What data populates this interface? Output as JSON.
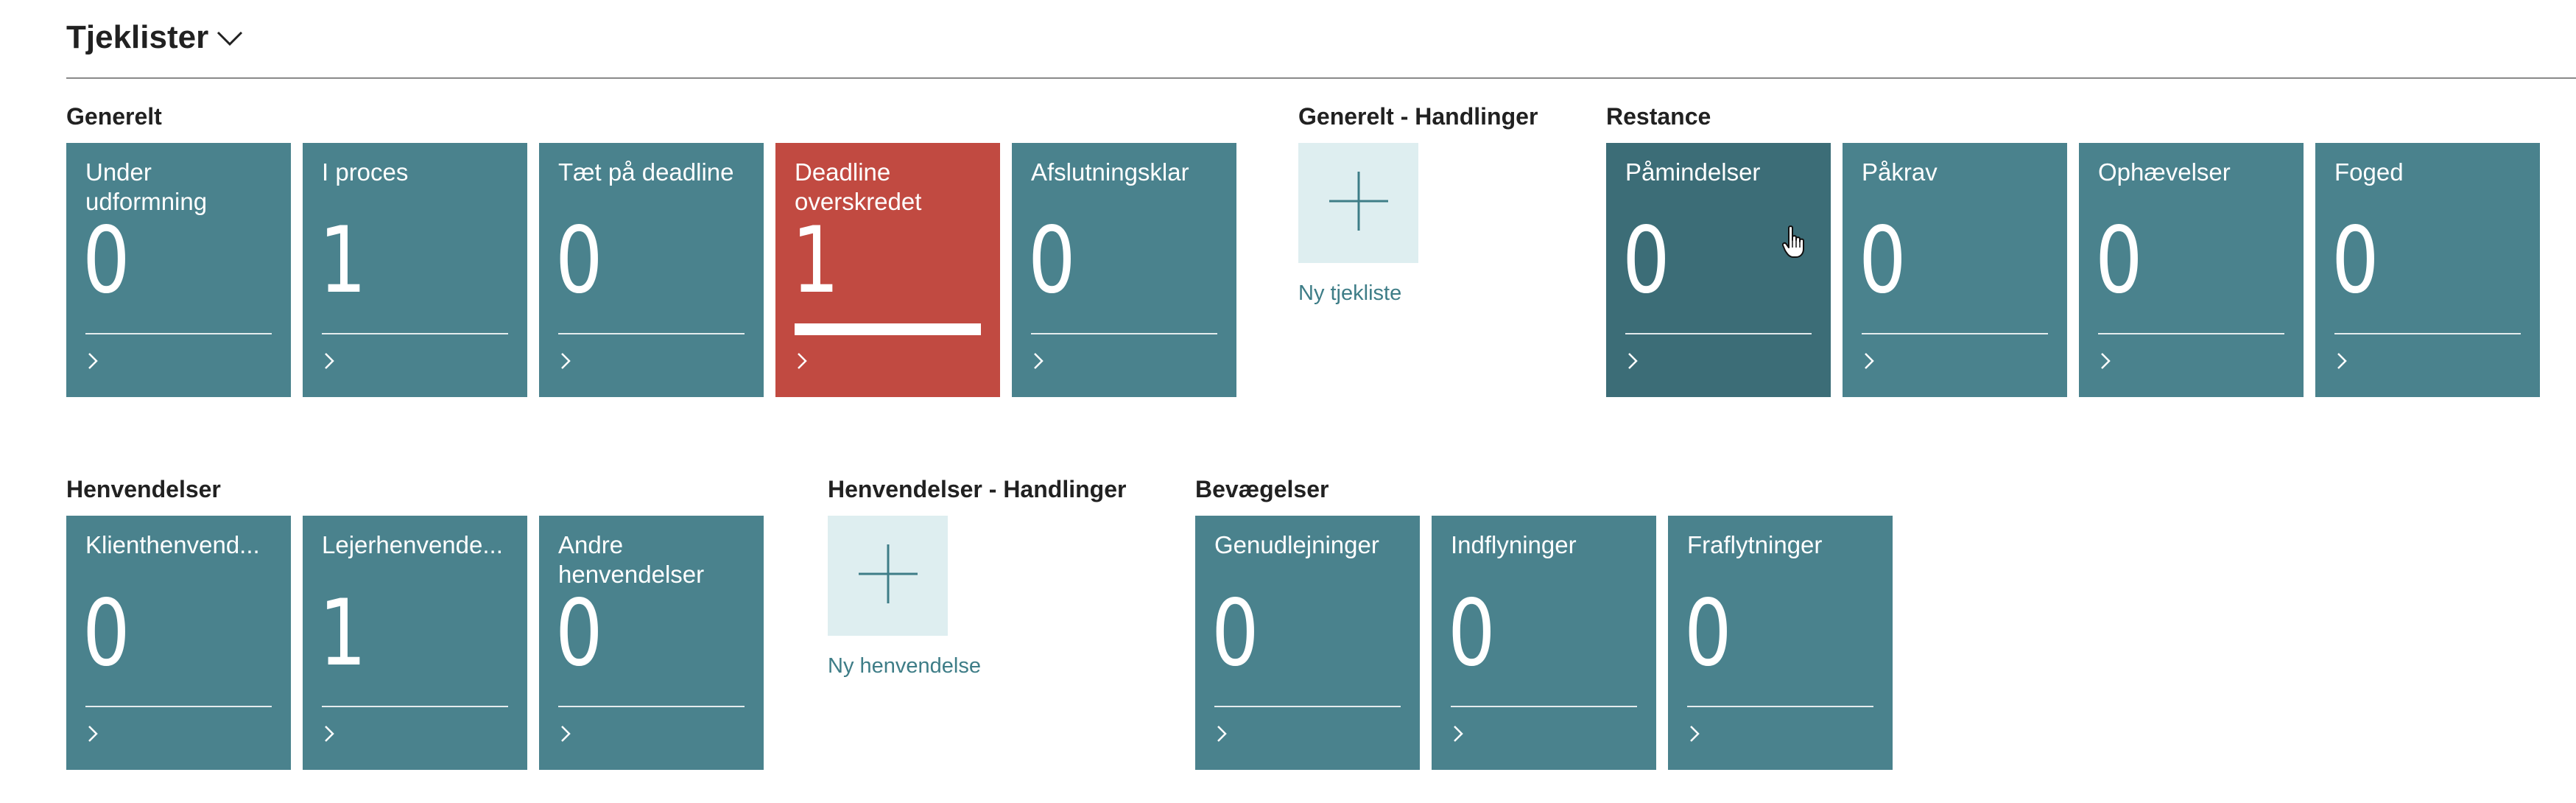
{
  "page": {
    "title": "Tjeklister"
  },
  "groups": {
    "generelt": {
      "title": "Generelt",
      "tiles": [
        {
          "label": "Under udformning",
          "value": "0"
        },
        {
          "label": "I proces",
          "value": "1"
        },
        {
          "label": "Tæt på deadline",
          "value": "0"
        },
        {
          "label": "Deadline overskredet",
          "value": "1"
        },
        {
          "label": "Afslutningsklar",
          "value": "0"
        }
      ]
    },
    "generelt_handlinger": {
      "title": "Generelt - Handlinger",
      "action_label": "Ny tjekliste"
    },
    "restance": {
      "title": "Restance",
      "tiles": [
        {
          "label": "Påmindelser",
          "value": "0"
        },
        {
          "label": "Påkrav",
          "value": "0"
        },
        {
          "label": "Ophævelser",
          "value": "0"
        },
        {
          "label": "Foged",
          "value": "0"
        }
      ]
    },
    "henvendelser": {
      "title": "Henvendelser",
      "tiles": [
        {
          "label": "Klienthenvend...",
          "value": "0"
        },
        {
          "label": "Lejerhenvende...",
          "value": "1"
        },
        {
          "label": "Andre henvendelser",
          "value": "0"
        }
      ]
    },
    "henvendelser_handlinger": {
      "title": "Henvendelser - Handlinger",
      "action_label": "Ny henvendelse"
    },
    "bevaegelser": {
      "title": "Bevægelser",
      "tiles": [
        {
          "label": "Genudlejninger",
          "value": "0"
        },
        {
          "label": "Indflyninger",
          "value": "0"
        },
        {
          "label": "Fraflytninger",
          "value": "0"
        }
      ]
    }
  },
  "colors": {
    "tile": "#4a828d",
    "tile_hover": "#3c6d77",
    "tile_alert": "#c14a41",
    "action_tile": "#deeef0",
    "link": "#3e7d87"
  },
  "icons": {
    "title_chevron": "chevron-down-icon",
    "tile_arrow": "chevron-right-icon",
    "action": "plus-icon",
    "cursor": "hand-pointer-icon"
  }
}
